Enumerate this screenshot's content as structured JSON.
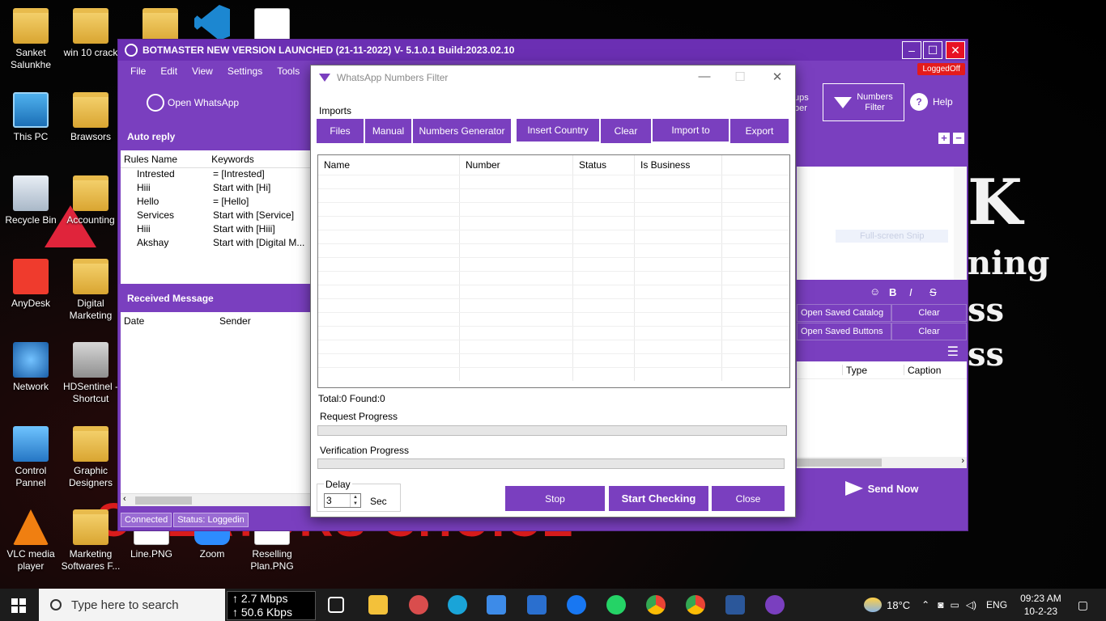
{
  "desktop": {
    "icons": [
      {
        "label": "Sanket Salunkhe"
      },
      {
        "label": "win 10 crack"
      },
      {
        "label": "This PC"
      },
      {
        "label": "Brawsors"
      },
      {
        "label": "Recycle Bin"
      },
      {
        "label": "Accounting"
      },
      {
        "label": "AnyDesk"
      },
      {
        "label": "Digital Marketing"
      },
      {
        "label": "Network"
      },
      {
        "label": "HDSentinel - Shortcut"
      },
      {
        "label": "Control Pannel"
      },
      {
        "label": "Graphic Designers"
      },
      {
        "label": "VLC media player"
      },
      {
        "label": "Marketing Softwares F..."
      },
      {
        "label": "Line.PNG"
      },
      {
        "label": "Zoom"
      },
      {
        "label": "Reselling Plan.PNG"
      }
    ],
    "wallpaper_text": {
      "k": "K",
      "line1": "ning",
      "line2": "ss",
      "line3": "ss",
      "red": "CREATORS CHOICE"
    }
  },
  "app": {
    "title": "BOTMASTER NEW VERSION LAUNCHED (21-11-2022) V- 5.1.0.1 Build:2023.02.10",
    "menu": [
      "File",
      "Edit",
      "View",
      "Settings",
      "Tools"
    ],
    "logged_badge": "LoggedOff",
    "toolbar": {
      "open_whatsapp": "Open WhatsApp",
      "groups_fragment_1": "ups",
      "groups_fragment_2": "ber",
      "numbers_filter_1": "Numbers",
      "numbers_filter_2": "Filter",
      "help": "Help"
    },
    "auto_reply": {
      "title": "Auto reply",
      "headers": [
        "Rules Name",
        "Keywords"
      ],
      "rows": [
        {
          "name": "Intrested",
          "keyword": "= [Intrested]"
        },
        {
          "name": "Hiii",
          "keyword": "Start with [Hi]"
        },
        {
          "name": "Hello",
          "keyword": "= [Hello]"
        },
        {
          "name": "Services",
          "keyword": "Start with [Service]"
        },
        {
          "name": "Hiii",
          "keyword": "Start with [Hiii]"
        },
        {
          "name": "Akshay",
          "keyword": "Start with [Digital M..."
        }
      ]
    },
    "received": {
      "title": "Received Message",
      "headers": [
        "Date",
        "Sender"
      ]
    },
    "status": {
      "connection": "Connected",
      "login": "Status: Loggedin"
    },
    "right": {
      "snip_hint": "Full-screen Snip",
      "format": {
        "emoji": "☺",
        "bold": "B",
        "italic": "I",
        "strike": "S"
      },
      "catalog": {
        "open": "Open Saved Catalog",
        "clear": "Clear"
      },
      "buttons": {
        "open": "Open Saved Buttons",
        "clear": "Clear"
      },
      "table_headers": [
        "Type",
        "Caption"
      ],
      "send_now": "Send Now"
    }
  },
  "dialog": {
    "title": "WhatsApp Numbers Filter",
    "imports_label": "Imports",
    "import_buttons": [
      "Files",
      "Manual",
      "Numbers Generator"
    ],
    "action_buttons": [
      "Insert Country",
      "Clear",
      "Import to",
      "Export"
    ],
    "columns": [
      "Name",
      "Number",
      "Status",
      "Is Business",
      ""
    ],
    "total_found": "Total:0 Found:0",
    "request_progress_label": "Request Progress",
    "request_progress": 0,
    "verification_progress_label": "Verification Progress",
    "verification_progress": 0,
    "delay": {
      "label": "Delay",
      "value": "3",
      "unit": "Sec"
    },
    "buttons": {
      "stop": "Stop",
      "start": "Start Checking",
      "close": "Close"
    }
  },
  "taskbar": {
    "search_placeholder": "Type here to search",
    "net_up": "↑ 2.7 Mbps",
    "net_down": "↑ 50.6 Kbps",
    "weather": "18°C",
    "language": "ENG",
    "time": "09:23 AM",
    "date": "10-2-23"
  }
}
